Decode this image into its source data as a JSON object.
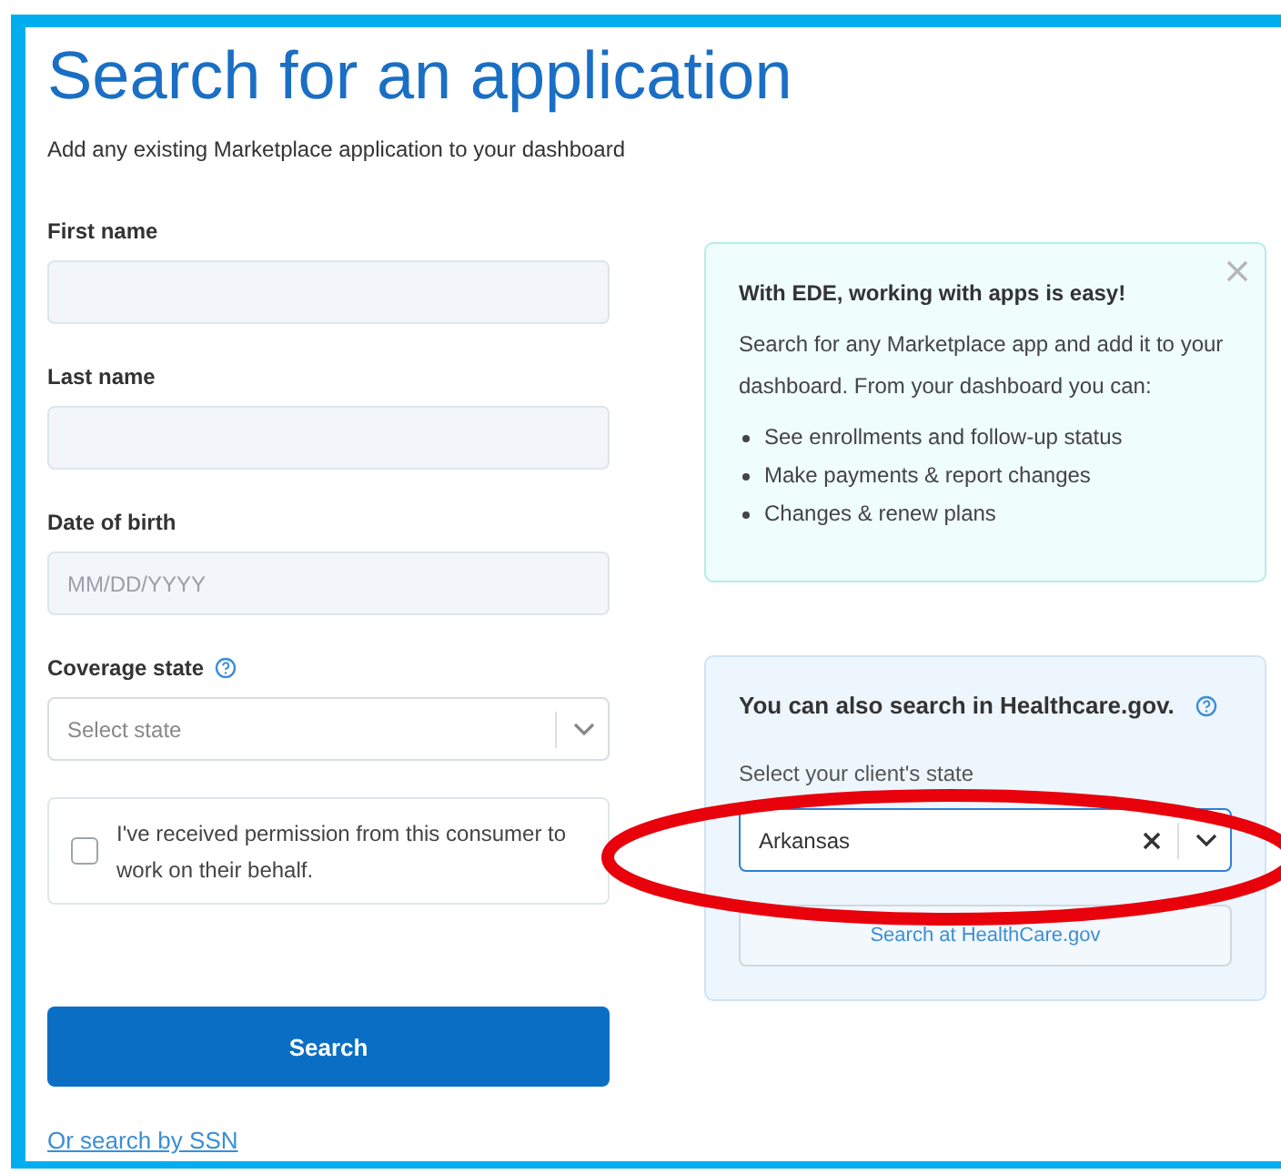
{
  "page": {
    "title": "Search for an application",
    "subtitle": "Add any existing Marketplace application to your dashboard"
  },
  "form": {
    "fields": [
      {
        "kind": "text",
        "label": "First name"
      },
      {
        "kind": "text",
        "label": "Last name"
      },
      {
        "kind": "text",
        "label": "Date of birth",
        "placeholder": "MM/DD/YYYY"
      },
      {
        "kind": "select",
        "label": "Coverage state",
        "help": true,
        "placeholder": "Select state"
      }
    ],
    "consent": {
      "label": "I've received permission from this consumer to work on their behalf.",
      "checked": false
    },
    "submit": "Search",
    "alt_link": "Or search by SSN"
  },
  "info_card": {
    "title": "With EDE, working with apps is easy!",
    "body": "Search for any Marketplace app and add it to your dashboard. From your dashboard you can:",
    "bullets": [
      "See enrollments and follow-up status",
      "Make payments & report changes",
      "Changes & renew plans"
    ],
    "closable": true
  },
  "healthcare_card": {
    "title": "You can also search in Healthcare.gov.",
    "help": true,
    "label": "Select your client's state",
    "value": "Arkansas",
    "button": "Search at HealthCare.gov"
  },
  "annotations": [
    {
      "kind": "ellipse"
    }
  ]
}
